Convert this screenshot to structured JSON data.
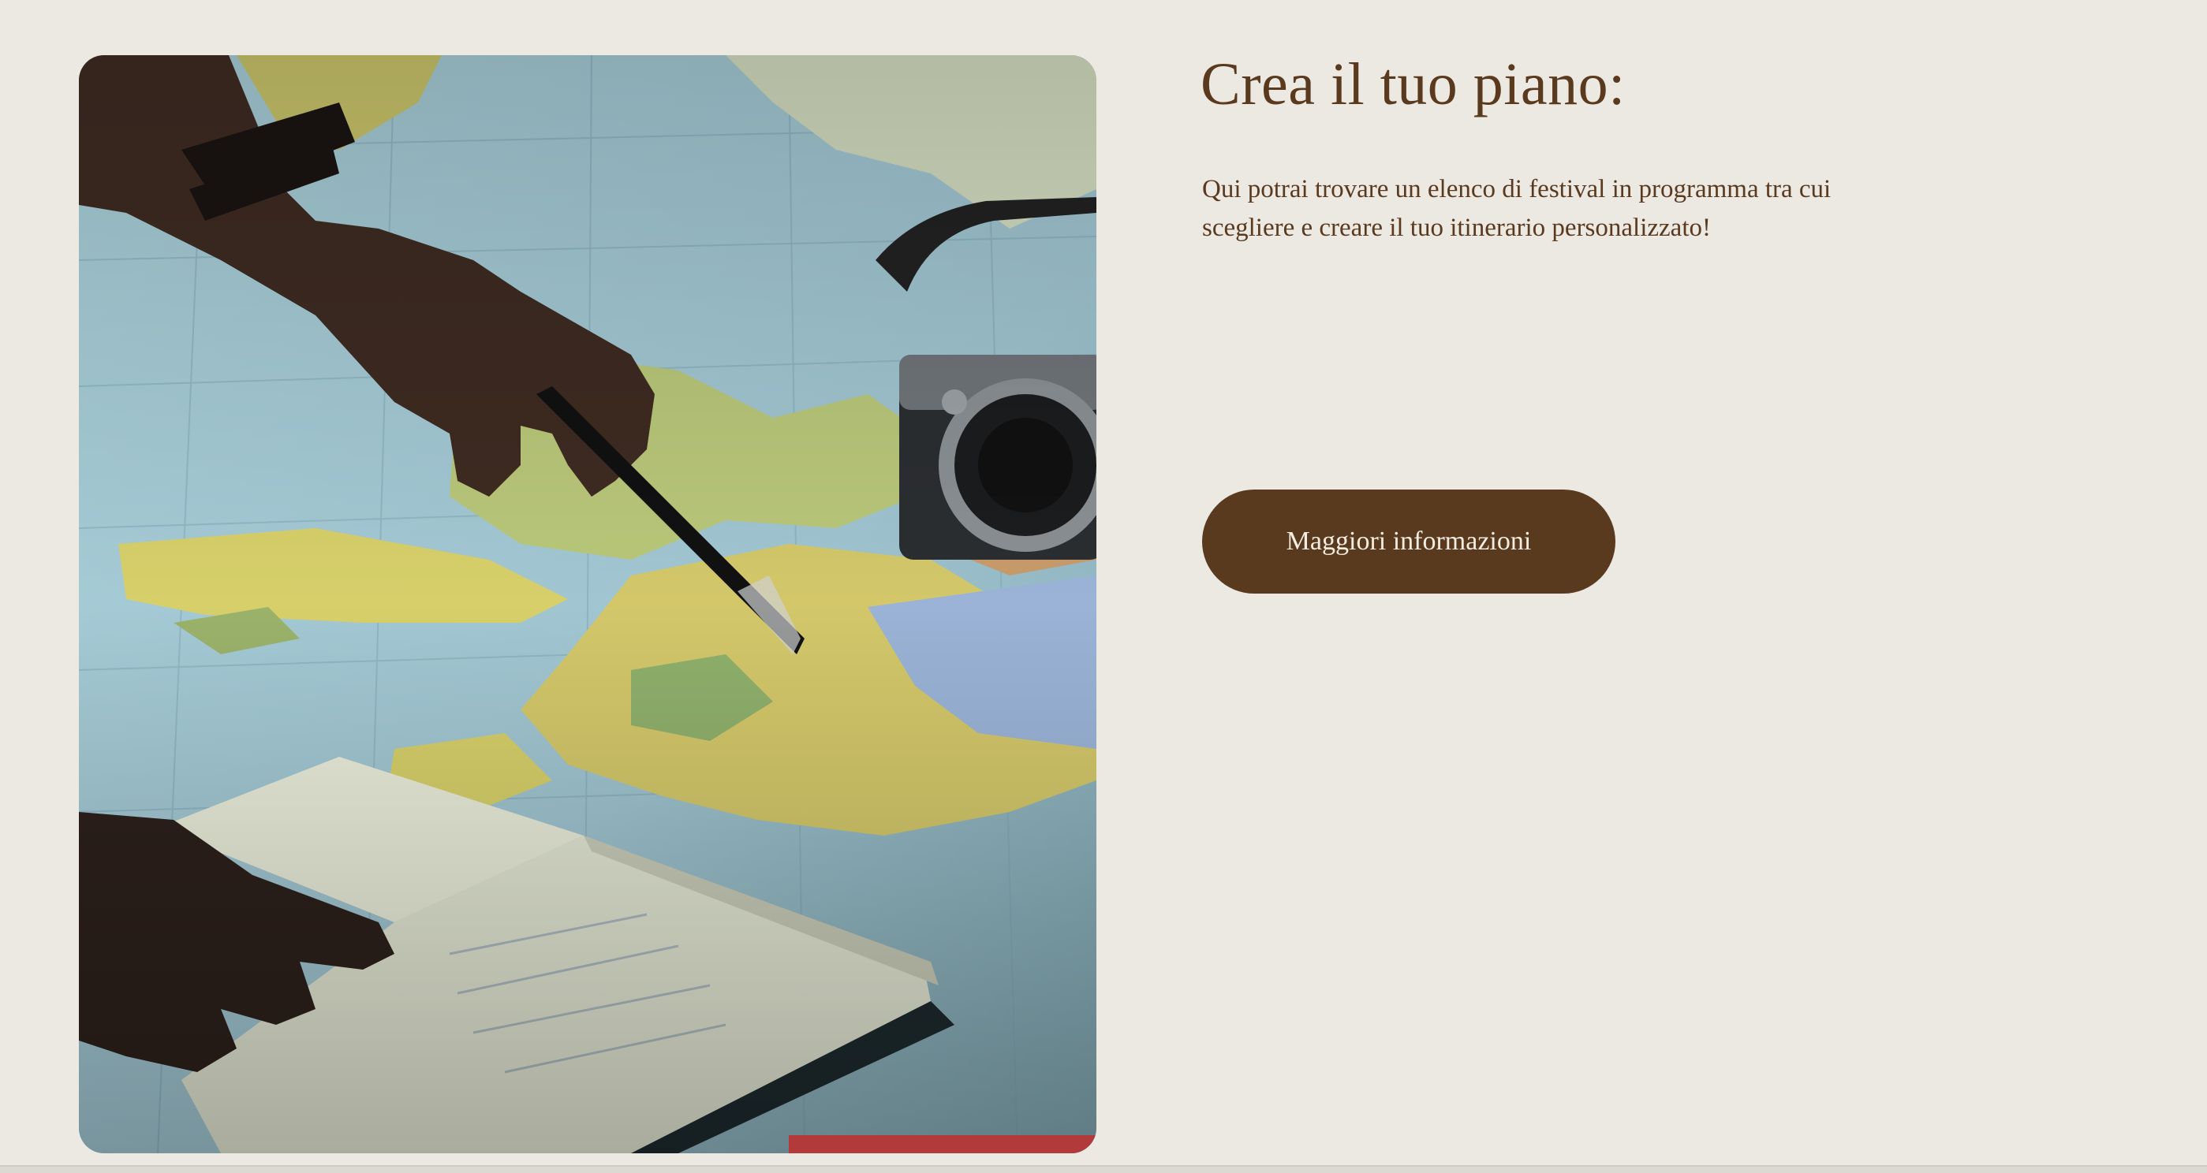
{
  "hero": {
    "image_description": "travel-map-photo",
    "title": "Crea il tuo piano:",
    "description": "Qui potrai trovare un elenco di festival in programma tra cui scegliere e creare il tuo itinerario personalizzato!",
    "cta_label": "Maggiori informazioni"
  },
  "colors": {
    "background": "#ece8e2",
    "accent_brown": "#5a3a1f",
    "button_text": "#f3ece0"
  }
}
